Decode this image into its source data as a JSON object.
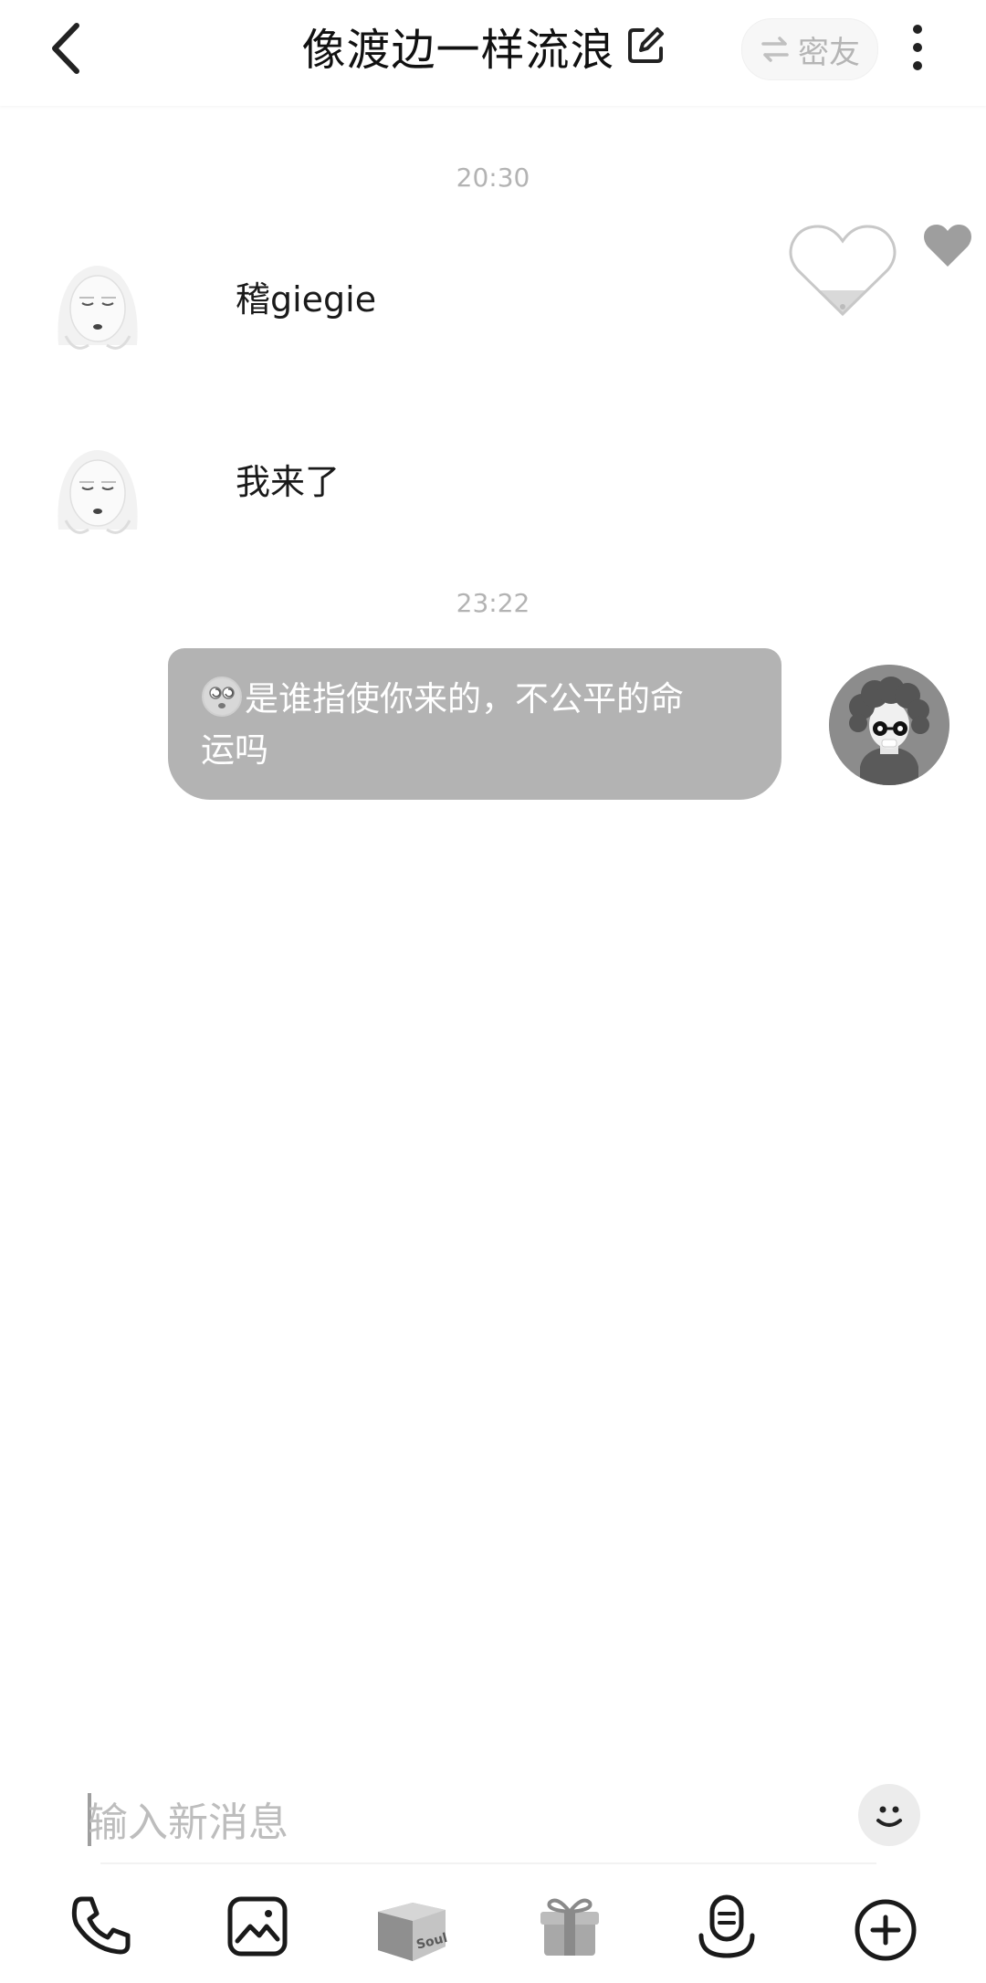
{
  "header": {
    "title": "像渡边一样流浪",
    "close_friend_label": "密友"
  },
  "chat": {
    "timestamps": [
      "20:30",
      "23:22"
    ],
    "received_messages": [
      {
        "text": "稽giegie"
      },
      {
        "text": "我来了"
      }
    ],
    "sent_message": {
      "line1": "是谁指使你来的，不公平的命",
      "line2": "运吗"
    }
  },
  "composer": {
    "placeholder": "输入新消息"
  },
  "toolbar": {
    "box_label": "Soul"
  },
  "colors": {
    "bubble": "#b3b3b3",
    "text": "#1a1a1a",
    "muted": "#b3b3b3"
  },
  "icons": [
    "back-icon",
    "edit-icon",
    "swap-icon",
    "more-icon",
    "heart-icon",
    "emoji-icon",
    "phone-icon",
    "image-icon",
    "box-icon",
    "gift-icon",
    "voice-match-icon",
    "plus-icon"
  ]
}
